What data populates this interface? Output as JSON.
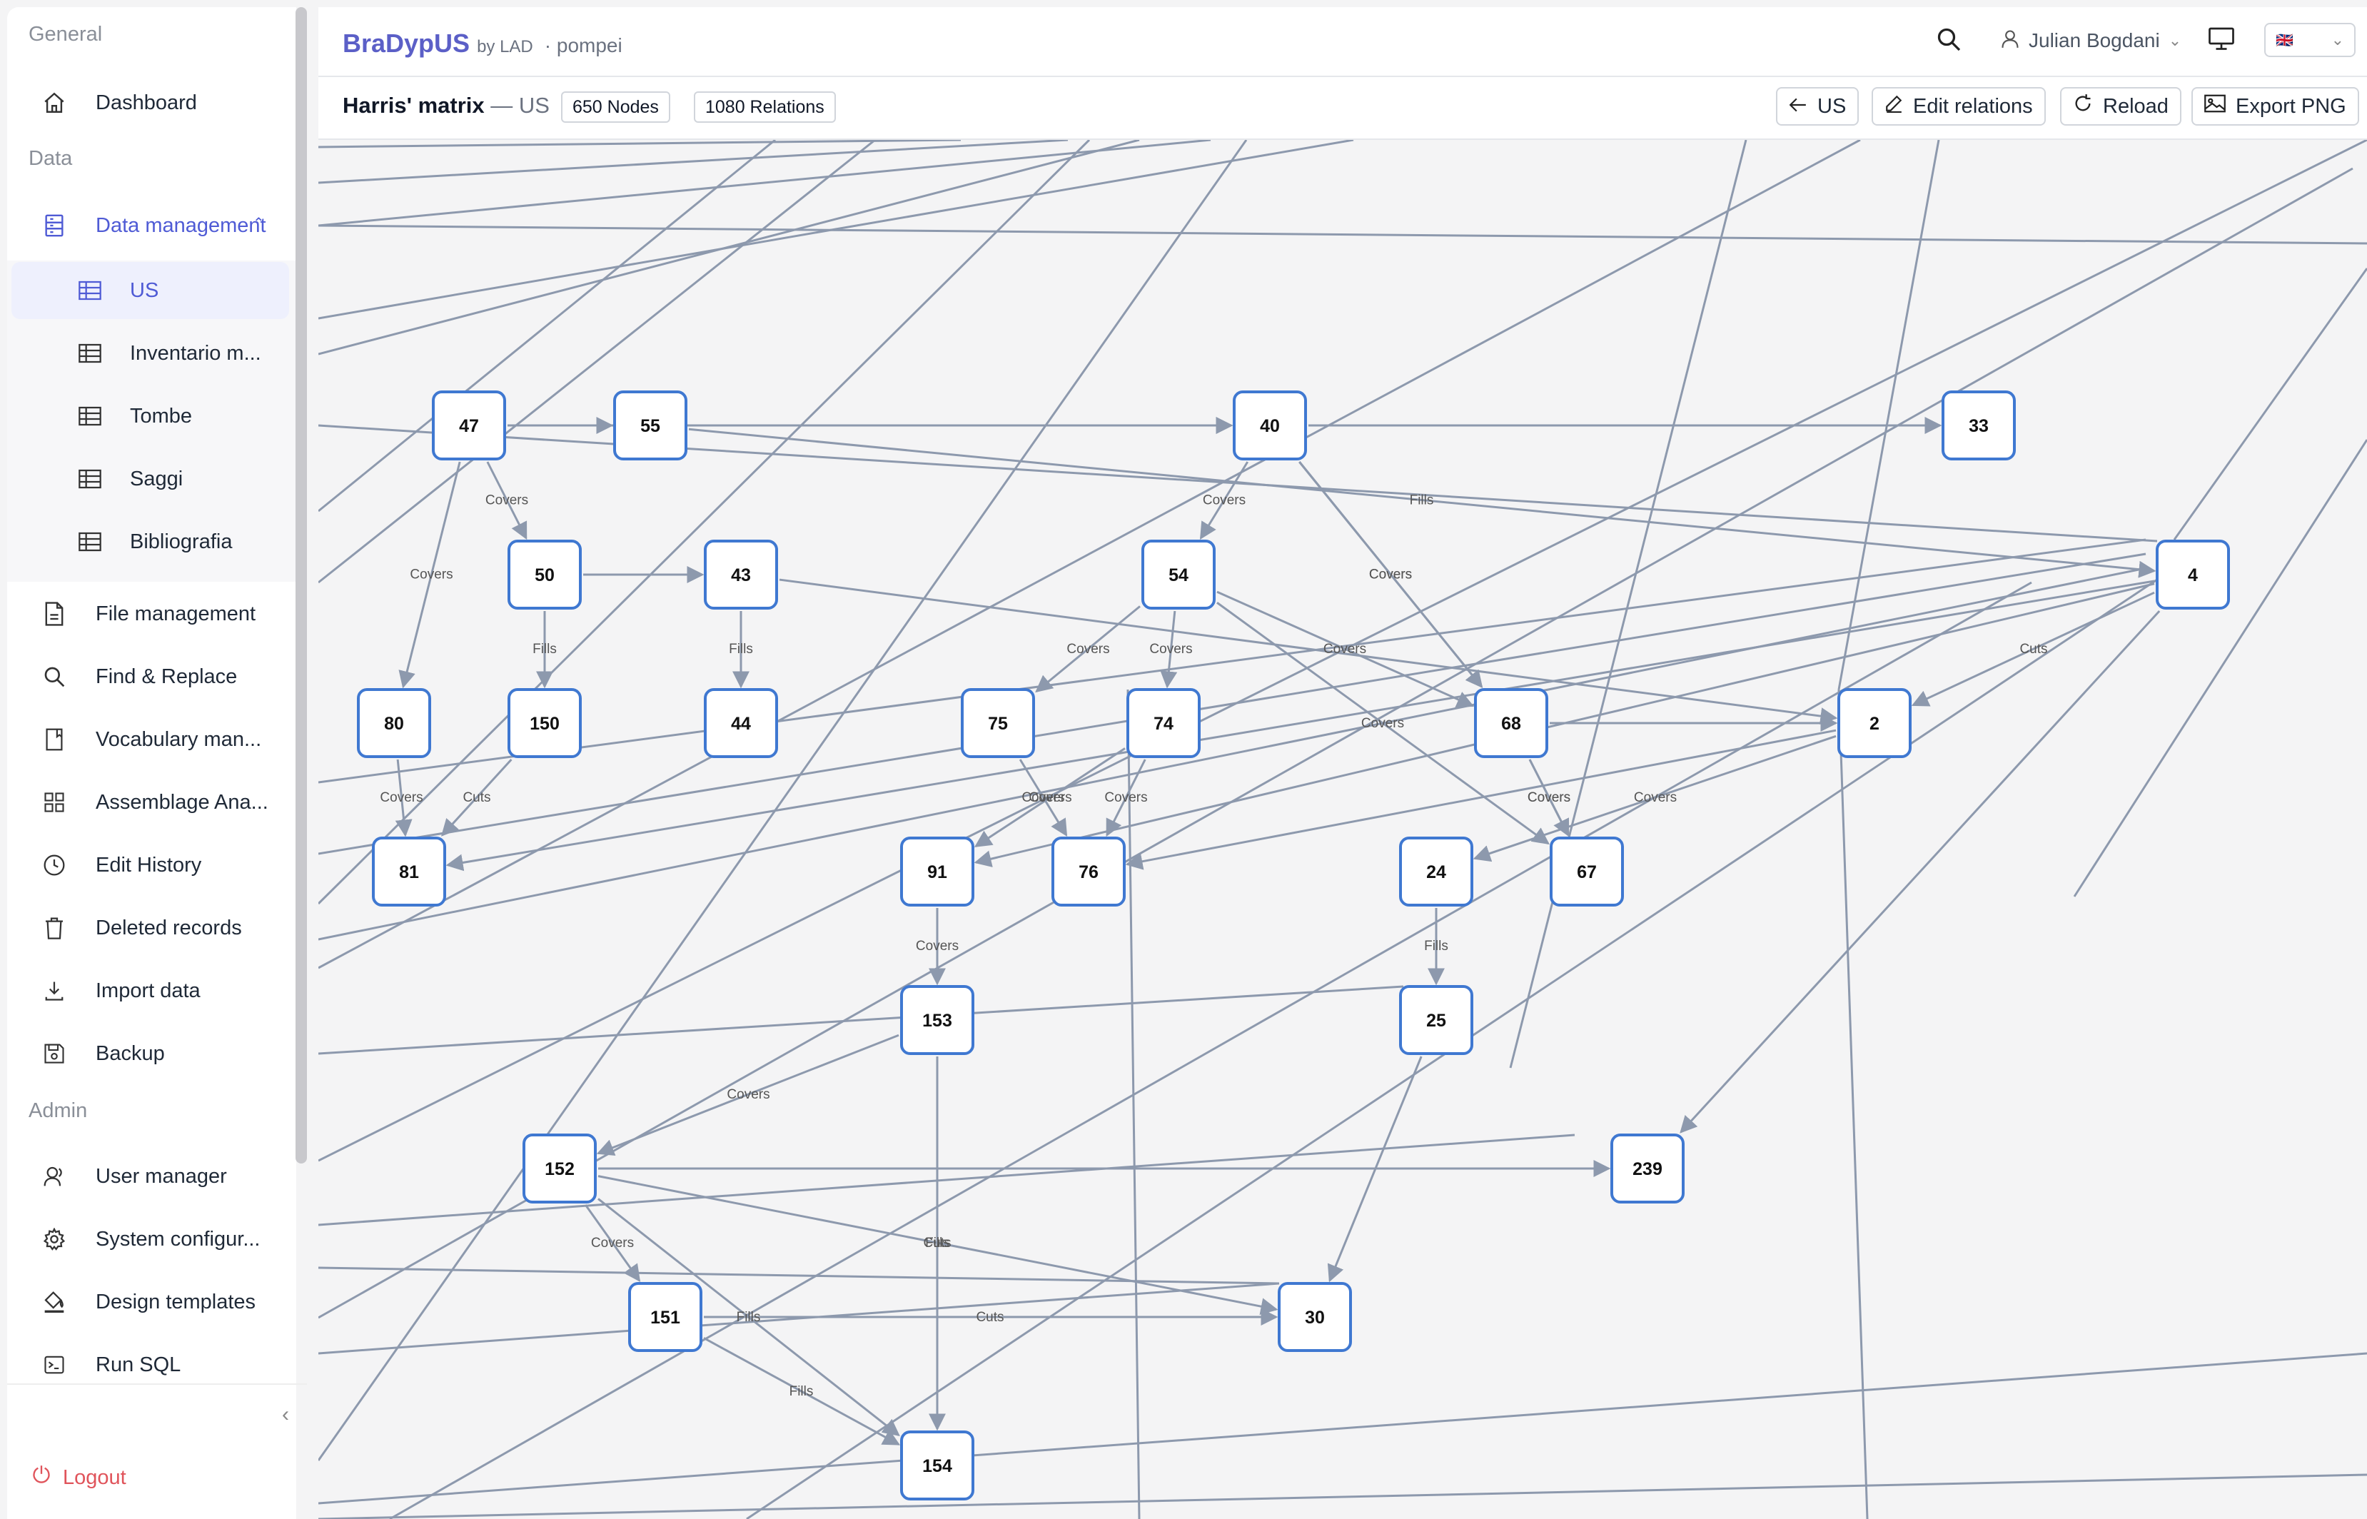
{
  "sidebar": {
    "sections": {
      "general": "General",
      "data": "Data",
      "admin": "Admin"
    },
    "items": {
      "dashboard": "Dashboard",
      "data_management": "Data management",
      "us": "US",
      "inventario": "Inventario m...",
      "tombe": "Tombe",
      "saggi": "Saggi",
      "bibliografia": "Bibliografia",
      "file_management": "File management",
      "find_replace": "Find & Replace",
      "vocabulary": "Vocabulary man...",
      "assemblage": "Assemblage Ana...",
      "edit_history": "Edit History",
      "deleted_records": "Deleted records",
      "import_data": "Import data",
      "backup": "Backup",
      "user_manager": "User manager",
      "system_config": "System configur...",
      "design_templates": "Design templates",
      "run_sql": "Run SQL"
    },
    "logout": "Logout"
  },
  "topbar": {
    "app_name": "BraDypUS",
    "by": "by LAD",
    "project": "· pompei",
    "user": "Julian Bogdani",
    "language": "🇬🇧"
  },
  "toolbar": {
    "title": "Harris' matrix",
    "subtitle": "— US",
    "nodes_badge": "650 Nodes",
    "relations_badge": "1080 Relations",
    "back_label": "US",
    "edit_label": "Edit relations",
    "reload_label": "Reload",
    "export_label": "Export PNG"
  },
  "graph": {
    "nodes": [
      "47",
      "55",
      "40",
      "33",
      "50",
      "43",
      "54",
      "4",
      "80",
      "150",
      "44",
      "75",
      "74",
      "68",
      "2",
      "81",
      "91",
      "76",
      "24",
      "67",
      "153",
      "25",
      "152",
      "239",
      "151",
      "30",
      "154"
    ],
    "edge_labels": [
      "Covers",
      "Fills",
      "Cuts"
    ]
  }
}
